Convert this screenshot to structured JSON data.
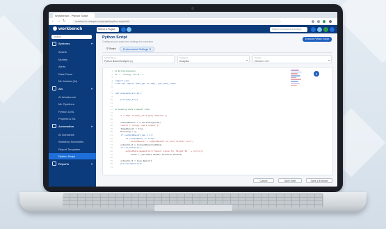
{
  "colors": {
    "brand": "#0c3b7c",
    "accent": "#1e5fbf",
    "active": "#1e6fd9"
  },
  "browser": {
    "tab_title": "Workbench - Python Script",
    "url": "workbench.example.com/project/python-script/edit"
  },
  "header": {
    "logo_text": "workbench",
    "project_select": "Select a Project",
    "search_placeholder": "Search resources and docs"
  },
  "sidebar": {
    "search_placeholder": "Search",
    "items": [
      {
        "label": "Systems",
        "type": "section",
        "icon": "server-icon"
      },
      {
        "label": "Assets",
        "type": "sub"
      },
      {
        "label": "Models",
        "type": "sub"
      },
      {
        "label": "Alerts",
        "type": "sub"
      },
      {
        "label": "Data Flows",
        "type": "sub"
      },
      {
        "label": "ML Models (AI)",
        "type": "sub"
      },
      {
        "label": "AIs",
        "type": "section",
        "icon": "gear-icon"
      },
      {
        "label": "AI Workbench",
        "type": "sub"
      },
      {
        "label": "ML Pipelines",
        "type": "sub"
      },
      {
        "label": "Python & ML",
        "type": "sub"
      },
      {
        "label": "Projects & ML",
        "type": "sub"
      },
      {
        "label": "Automation",
        "type": "section",
        "icon": "bolt-icon"
      },
      {
        "label": "AI Scenarios",
        "type": "sub"
      },
      {
        "label": "Workflow Schedules",
        "type": "sub"
      },
      {
        "label": "Report Templates",
        "type": "sub"
      },
      {
        "label": "Python Script",
        "type": "sub",
        "active": true
      },
      {
        "label": "Reports",
        "type": "section",
        "icon": "pen-icon"
      }
    ]
  },
  "main": {
    "title": "Python Script",
    "description": "Configure your script and settings for execution",
    "top_button": "Execute Python Script",
    "tabs": [
      "Script",
      "Environment Settings"
    ],
    "fields": [
      {
        "label": "Script Name",
        "value": "Python Based Analysis (1)"
      },
      {
        "label": "Category",
        "value": "Analytics"
      },
      {
        "label": "Version",
        "value": "Version 1.0.0"
      }
    ],
    "code": [
      "# Initialization",
      "# -*- coding: utf-8 -*-",
      "",
      "import json",
      "from api import data_api as dapi, get_data_frame",
      "",
      "",
      "def evaluate(script):",
      "",
      "    print(my_dict)",
      "",
      "",
      "# Loading data request code",
      "",
      "    d = dapi.load(my_dict.get('dataset'))",
      "",
      "    outputResult = d.evaluate(param)",
      "    result = (step['input_output'])",
      "    ImageResult = True",
      "    Encoding = []",
      "    if (outputResult_len > 1):",
      "        if (outputDuty == true):",
      "            outputResult = outputResult.to_dict(orient='list')",
      "    outputList = {outputRequiredData}",
      "    if (is_Solution):",
      "        outputData.append(str('Sensor value for Target ID ' + str(n)))",
      "            index = (Variable Header Solution Parsed)",
      "",
      "    outputList = [new Report]",
      "    print(outputList)",
      ""
    ],
    "bottom_buttons": [
      "Cancel",
      "Save Draft",
      "Save & Execute"
    ]
  }
}
